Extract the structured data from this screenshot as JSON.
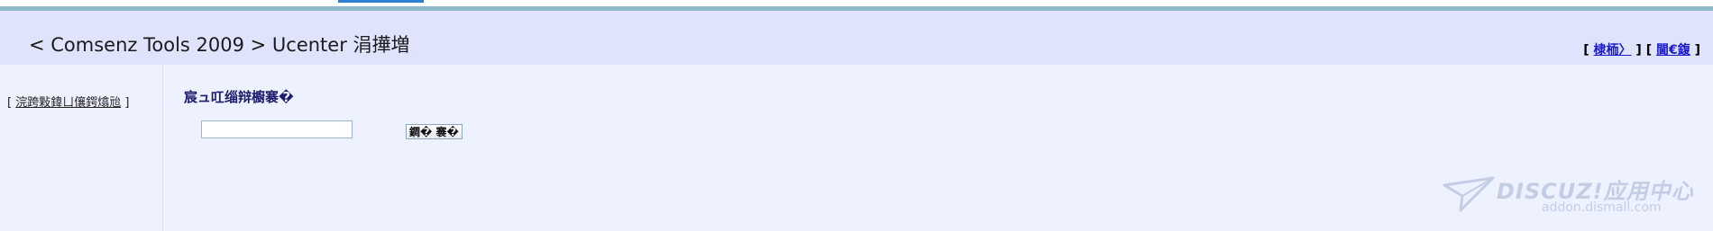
{
  "header": {
    "title": "< Comsenz Tools 2009 > Ucenter 涓撶増",
    "links": [
      {
        "label": "棣栭〉"
      },
      {
        "label": "閫€鍑"
      }
    ]
  },
  "sidebar": {
    "link_label": "浣跨敤鍏ㄩ儴鍔熻兘"
  },
  "main": {
    "heading": "宸ュ叿缁辩櫥褰�",
    "input_value": "",
    "submit_label": "鐧� 褰�"
  },
  "watermark": {
    "brand": "DISCUZ!应用中心",
    "domain": "addon.dismall.com"
  },
  "colors": {
    "header_bg": "#dfe3fc",
    "page_bg": "#eef1fe",
    "accent_tab": "#2f7fd5",
    "rule": "#8fb8c9",
    "link": "#1a1acc"
  }
}
